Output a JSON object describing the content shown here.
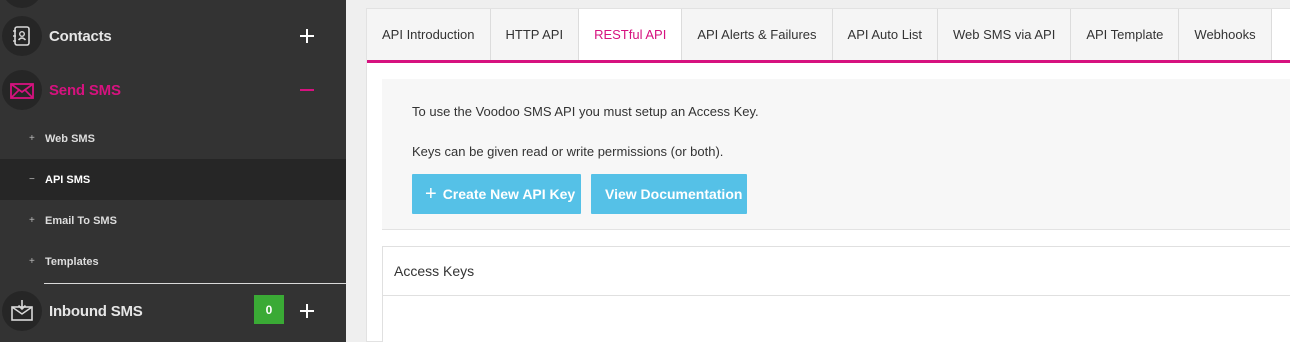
{
  "sidebar": {
    "contacts": {
      "label": "Contacts",
      "icon": "address-book-icon",
      "action": "plus"
    },
    "send_sms": {
      "label": "Send SMS",
      "icon": "envelope-icon",
      "action": "minus",
      "items": [
        {
          "mark": "+",
          "label": "Web SMS"
        },
        {
          "mark": "−",
          "label": "API SMS"
        },
        {
          "mark": "+",
          "label": "Email To SMS"
        },
        {
          "mark": "+",
          "label": "Templates"
        }
      ]
    },
    "inbound_sms": {
      "label": "Inbound SMS",
      "icon": "inbox-download-icon",
      "badge": "0",
      "action": "plus"
    }
  },
  "tabs": [
    {
      "label": "API Introduction"
    },
    {
      "label": "HTTP API"
    },
    {
      "label": "RESTful API"
    },
    {
      "label": "API Alerts & Failures"
    },
    {
      "label": "API Auto List"
    },
    {
      "label": "Web SMS via API"
    },
    {
      "label": "API Template"
    },
    {
      "label": "Webhooks"
    }
  ],
  "info": {
    "line1": "To use the Voodoo SMS API you must setup an Access Key.",
    "line2": "Keys can be given read or write permissions (or both).",
    "create_button": "Create New API Key",
    "docs_button": "View Documentation"
  },
  "access_keys": {
    "title": "Access Keys"
  },
  "colors": {
    "accent": "#d6127f",
    "button": "#55c1e7",
    "badge": "#3aaa35",
    "sidebar": "#333333"
  }
}
